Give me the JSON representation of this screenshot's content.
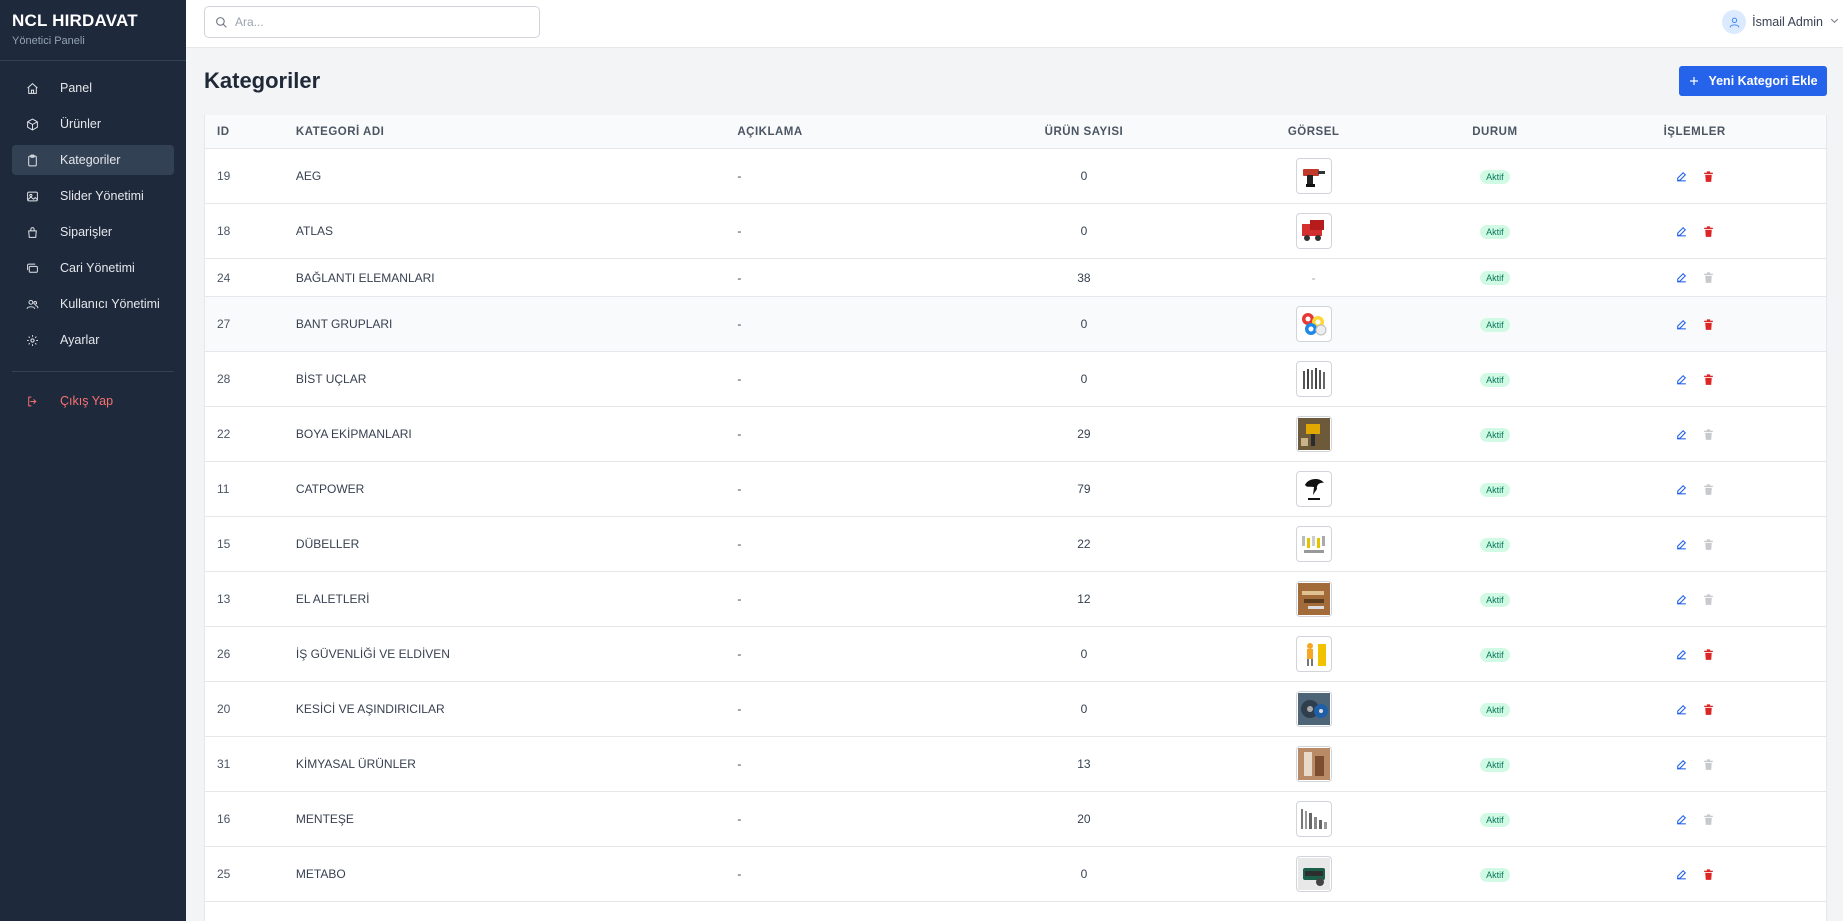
{
  "brand": {
    "title": "NCL HIRDAVAT",
    "subtitle": "Yönetici Paneli"
  },
  "sidebar": {
    "items": [
      {
        "label": "Panel",
        "icon": "home-icon"
      },
      {
        "label": "Ürünler",
        "icon": "box-icon"
      },
      {
        "label": "Kategoriler",
        "icon": "clipboard-icon",
        "active": true
      },
      {
        "label": "Slider Yönetimi",
        "icon": "image-icon"
      },
      {
        "label": "Siparişler",
        "icon": "bag-icon"
      },
      {
        "label": "Cari Yönetimi",
        "icon": "cards-icon"
      },
      {
        "label": "Kullanıcı Yönetimi",
        "icon": "users-icon"
      },
      {
        "label": "Ayarlar",
        "icon": "gear-icon"
      }
    ],
    "logout_label": "Çıkış Yap"
  },
  "search": {
    "placeholder": "Ara...",
    "value": ""
  },
  "user": {
    "name": "İsmail Admin"
  },
  "page": {
    "title": "Kategoriler",
    "add_button": "Yeni Kategori Ekle"
  },
  "table": {
    "headers": {
      "id": "ID",
      "name": "KATEGORİ ADI",
      "description": "AÇIKLAMA",
      "count": "ÜRÜN SAYISI",
      "image": "GÖRSEL",
      "status": "DURUM",
      "actions": "İŞLEMLER"
    },
    "rows": [
      {
        "id": "19",
        "name": "AEG",
        "description": "-",
        "count": "0",
        "image": "drill",
        "status": "Aktif",
        "can_delete": true
      },
      {
        "id": "18",
        "name": "ATLAS",
        "description": "-",
        "count": "0",
        "image": "machine",
        "status": "Aktif",
        "can_delete": true
      },
      {
        "id": "24",
        "name": "BAĞLANTI ELEMANLARI",
        "description": "-",
        "count": "38",
        "image": null,
        "image_placeholder": "-",
        "status": "Aktif",
        "can_delete": false
      },
      {
        "id": "27",
        "name": "BANT GRUPLARI",
        "description": "-",
        "count": "0",
        "image": "tapes",
        "status": "Aktif",
        "can_delete": true
      },
      {
        "id": "28",
        "name": "BİST UÇLAR",
        "description": "-",
        "count": "0",
        "image": "bits",
        "status": "Aktif",
        "can_delete": true
      },
      {
        "id": "22",
        "name": "BOYA EKİPMANLARI",
        "description": "-",
        "count": "29",
        "image": "paint",
        "status": "Aktif",
        "can_delete": false
      },
      {
        "id": "11",
        "name": "CATPOWER",
        "description": "-",
        "count": "79",
        "image": "panther",
        "status": "Aktif",
        "can_delete": false
      },
      {
        "id": "15",
        "name": "DÜBELLER",
        "description": "-",
        "count": "22",
        "image": "dowels",
        "status": "Aktif",
        "can_delete": false
      },
      {
        "id": "13",
        "name": "EL ALETLERİ",
        "description": "-",
        "count": "12",
        "image": "handtools",
        "status": "Aktif",
        "can_delete": false
      },
      {
        "id": "26",
        "name": "İŞ GÜVENLİĞİ VE ELDİVEN",
        "description": "-",
        "count": "0",
        "image": "safety",
        "status": "Aktif",
        "can_delete": true
      },
      {
        "id": "20",
        "name": "KESİCİ VE AŞINDIRICILAR",
        "description": "-",
        "count": "0",
        "image": "discs",
        "status": "Aktif",
        "can_delete": true
      },
      {
        "id": "31",
        "name": "KİMYASAL ÜRÜNLER",
        "description": "-",
        "count": "13",
        "image": "chemical",
        "status": "Aktif",
        "can_delete": false
      },
      {
        "id": "16",
        "name": "MENTEŞE",
        "description": "-",
        "count": "20",
        "image": "hinges",
        "status": "Aktif",
        "can_delete": false
      },
      {
        "id": "25",
        "name": "METABO",
        "description": "-",
        "count": "0",
        "image": "grinder",
        "status": "Aktif",
        "can_delete": true
      }
    ]
  },
  "colors": {
    "sidebar_bg": "#1e293b",
    "accent": "#2563eb",
    "danger": "#dc2626",
    "success_bg": "#d1fae5",
    "success_text": "#047857"
  }
}
